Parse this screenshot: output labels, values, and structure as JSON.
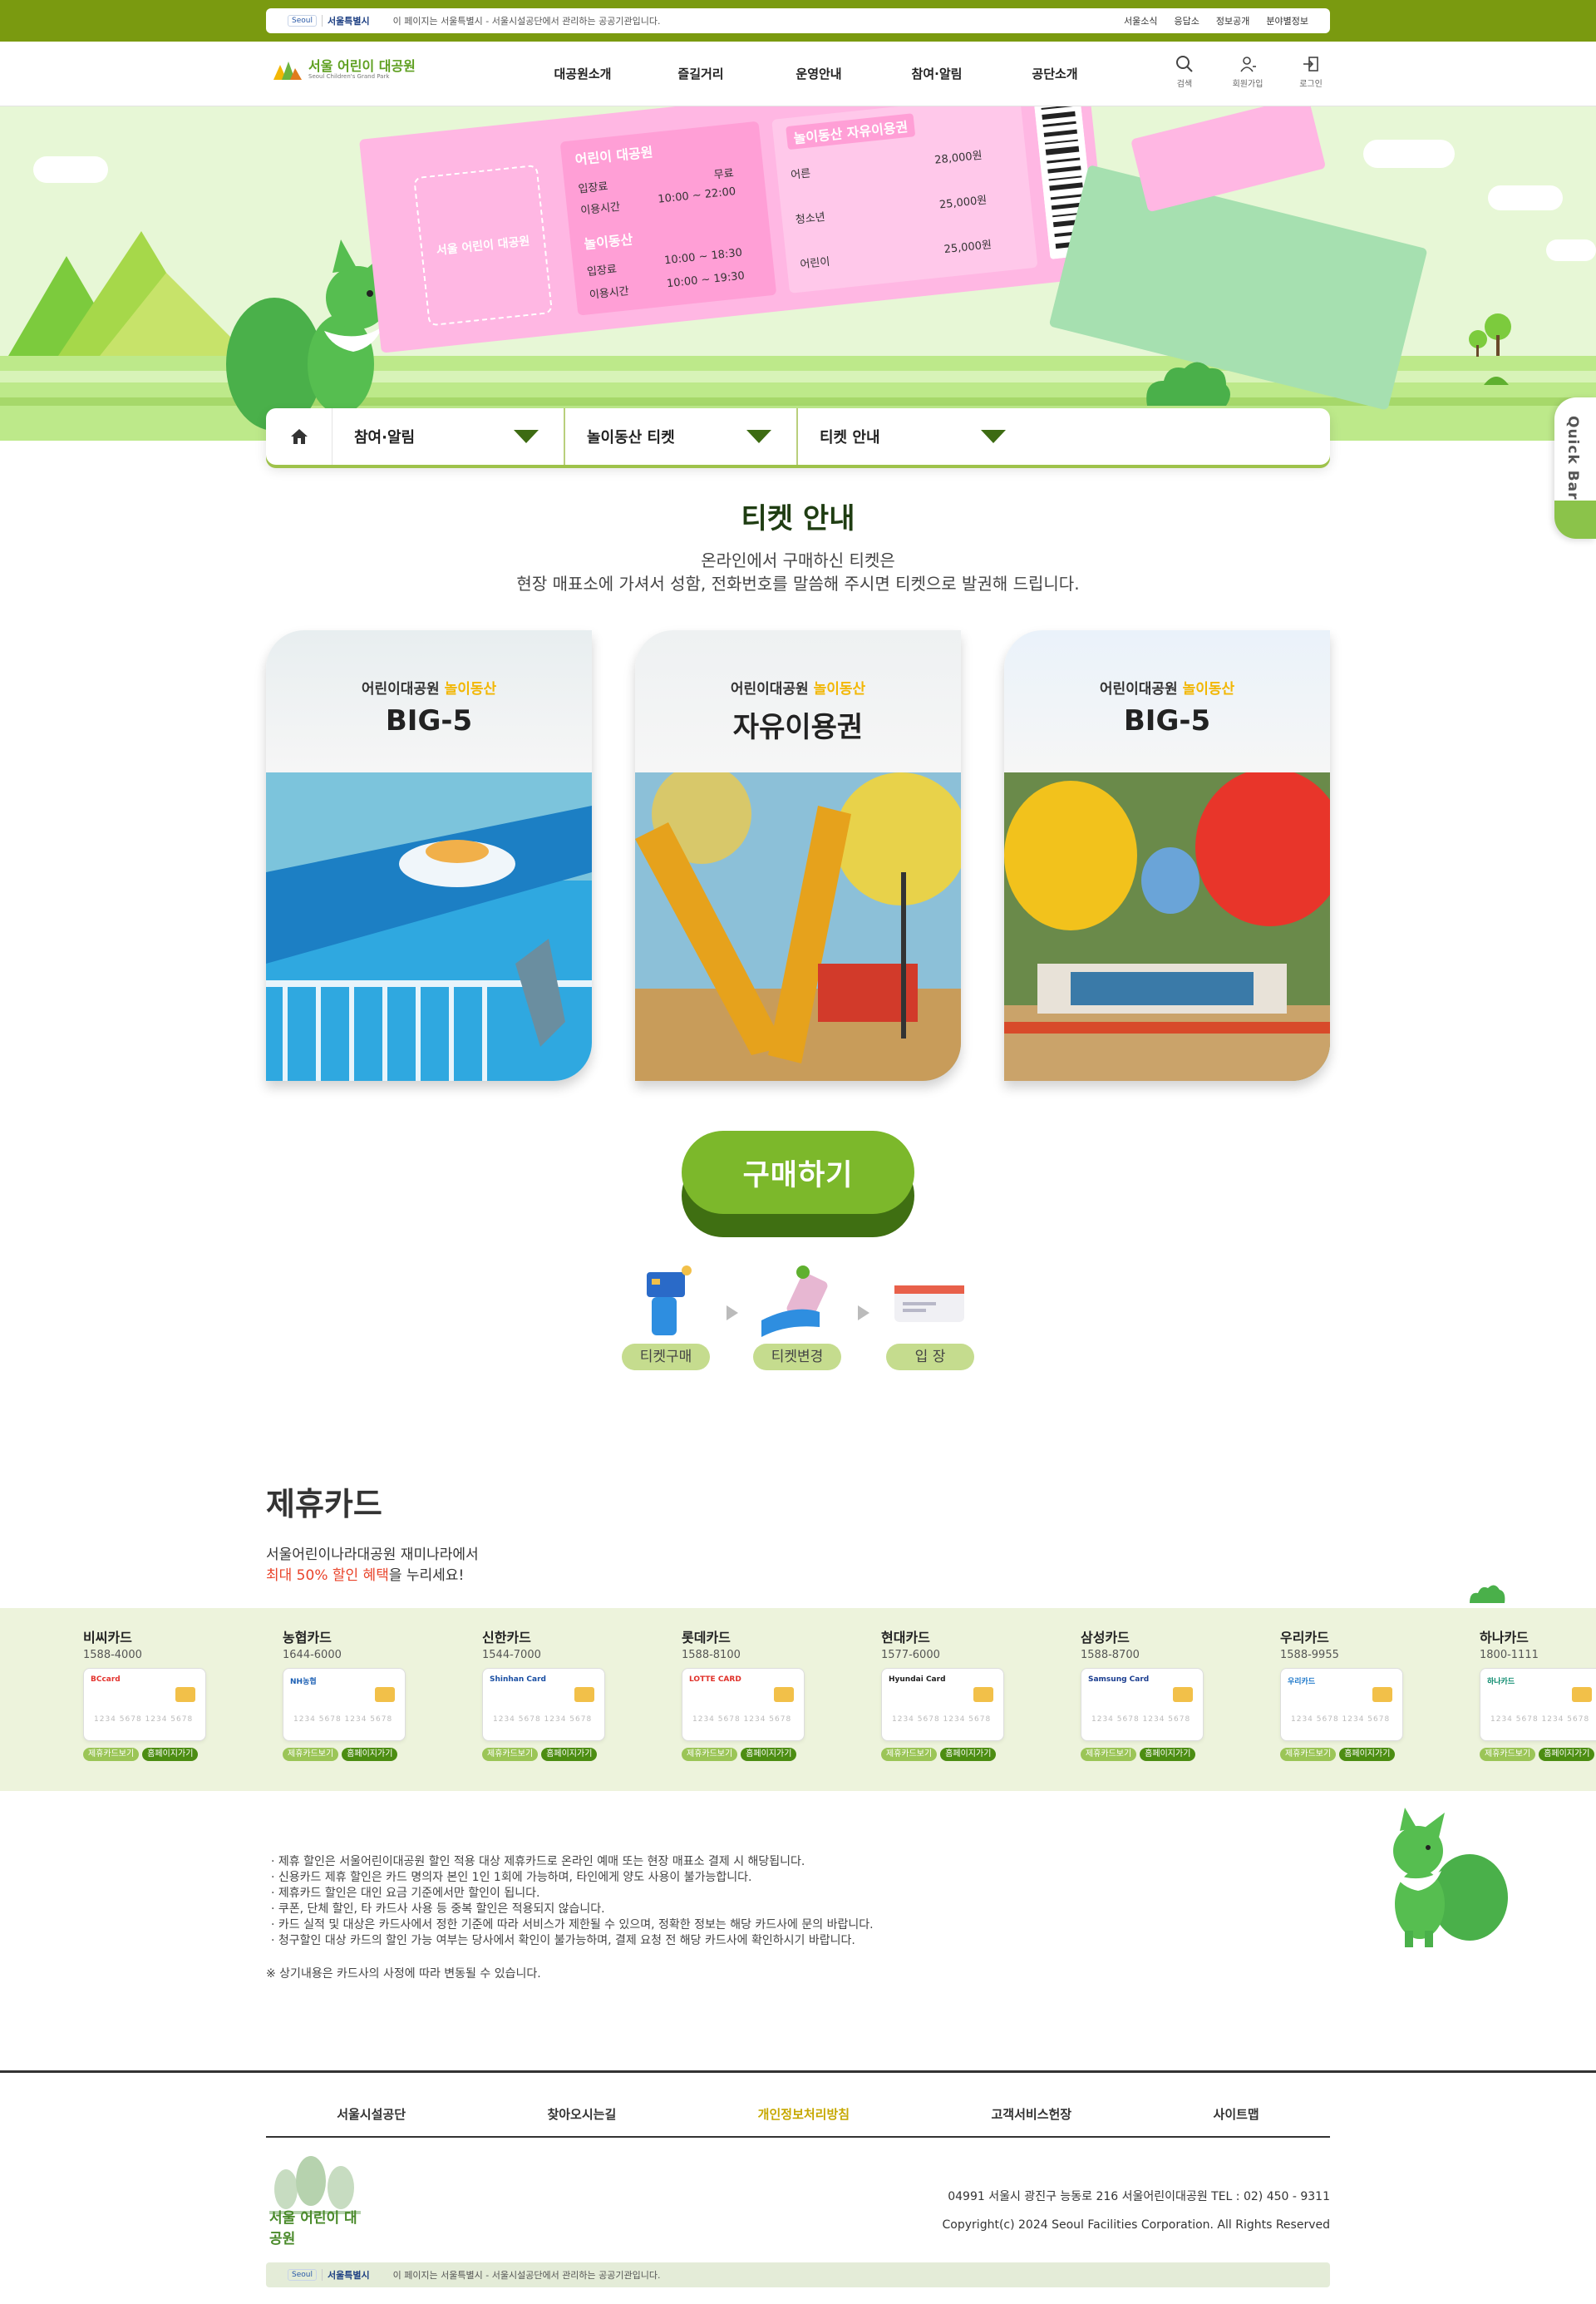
{
  "topbar": {
    "gov_logo_small": "Seoul",
    "gov_logo_main": "서울특별시",
    "notice": "이 페이지는 서울특별시 - 서울시설공단에서 관리하는 공공기관입니다.",
    "links": [
      "서울소식",
      "응답소",
      "정보공개",
      "분야별정보"
    ]
  },
  "header": {
    "logo_ko": "서울 어린이 대공원",
    "logo_en": "Seoul Children's Grand Park",
    "menu": [
      "대공원소개",
      "즐길거리",
      "운영안내",
      "참여·알림",
      "공단소개"
    ],
    "utils": {
      "search": "검색",
      "join": "회원가입",
      "login": "로그인"
    }
  },
  "hero": {
    "ticket_park_title": "어린이 대공원",
    "ticket_park_entry": "입장료",
    "ticket_park_entry_val": "무료",
    "ticket_park_hours": "이용시간",
    "ticket_park_hours_val": "10:00 ~ 22:00",
    "ticket_ride_title": "놀이동산",
    "ticket_ride_entry": "입장료",
    "ticket_ride_entry_val": "10:00 ~ 18:30",
    "ticket_ride_hours": "이용시간",
    "ticket_ride_hours_val": "10:00 ~ 19:30",
    "ticket_free_title": "놀이동산 자유이용권",
    "prices": [
      {
        "label": "어른",
        "value": "28,000원"
      },
      {
        "label": "청소년",
        "value": "25,000원"
      },
      {
        "label": "어린이",
        "value": "25,000원"
      }
    ],
    "stamp": "서울 어린이 대공원"
  },
  "subnav": {
    "items": [
      "참여·알림",
      "놀이동산 티켓",
      "티켓 안내"
    ]
  },
  "quickbar": {
    "label": "Quick Bar"
  },
  "main": {
    "title": "티켓 안내",
    "desc_line1": "온라인에서 구매하신 티켓은",
    "desc_line2": "현장 매표소에 가셔서 성함, 전화번호를 말씀해 주시면 티켓으로 발권해 드립니다.",
    "cards": [
      {
        "sub_a": "어린이대공원",
        "sub_b": "놀이동산",
        "big": "BIG-5"
      },
      {
        "sub_a": "어린이대공원",
        "sub_b": "놀이동산",
        "big": "자유이용권"
      },
      {
        "sub_a": "어린이대공원",
        "sub_b": "놀이동산",
        "big": "BIG-5"
      }
    ],
    "buy_button": "구매하기",
    "steps": [
      "티켓구매",
      "티켓변경",
      "입  장"
    ]
  },
  "partner": {
    "title": "제휴카드",
    "desc_line1": "서울어린이나라대공원 재미나라에서",
    "desc_highlight": "최대 50% 할인 혜택",
    "desc_tail": "을 누리세요!",
    "button_view": "제휴카드보기",
    "button_pay": "홈페이지가기",
    "card_number": "1234 5678 1234 5678",
    "cards": [
      {
        "name": "비씨카드",
        "tel": "1588-4000",
        "brand": "BCcard",
        "color": "#e3342f"
      },
      {
        "name": "농협카드",
        "tel": "1644-6000",
        "brand": "NH농협",
        "color": "#1b5fb4"
      },
      {
        "name": "신한카드",
        "tel": "1544-7000",
        "brand": "Shinhan Card",
        "color": "#1a4fa3"
      },
      {
        "name": "롯데카드",
        "tel": "1588-8100",
        "brand": "LOTTE CARD",
        "color": "#e0312a"
      },
      {
        "name": "현대카드",
        "tel": "1577-6000",
        "brand": "Hyundai Card",
        "color": "#222222"
      },
      {
        "name": "삼성카드",
        "tel": "1588-8700",
        "brand": "Samsung Card",
        "color": "#1a3d8f"
      },
      {
        "name": "우리카드",
        "tel": "1588-9955",
        "brand": "우리카드",
        "color": "#1a76c9"
      },
      {
        "name": "하나카드",
        "tel": "1800-1111",
        "brand": "하나카드",
        "color": "#0a8a6d"
      }
    ]
  },
  "notes": [
    "· 제휴 할인은 서울어린이대공원 할인 적용 대상 제휴카드로 온라인 예매 또는 현장 매표소 결제 시 해당됩니다.",
    "· 신용카드 제휴 할인은 카드 명의자 본인 1인 1회에 가능하며, 타인에게 양도 사용이 불가능합니다.",
    "· 제휴카드 할인은 대인 요금 기준에서만 할인이 됩니다.",
    "· 쿠폰, 단체 할인, 타 카드사 사용 등 중복 할인은 적용되지 않습니다.",
    "· 카드 실적 및 대상은 카드사에서 정한 기준에 따라 서비스가 제한될 수 있으며, 정확한 정보는 해당 카드사에 문의 바랍니다.",
    "· 청구할인 대상 카드의 할인 가능 여부는 당사에서 확인이 불가능하며, 결제 요청 전 해당 카드사에 확인하시기 바랍니다."
  ],
  "remark": "※ 상기내용은 카드사의 사정에 따라 변동될 수 있습니다.",
  "footer": {
    "nav": [
      "서울시설공단",
      "찾아오시는길",
      "개인정보처리방침",
      "고객서비스헌장",
      "사이트맵"
    ],
    "logo": "서울 어린이 대공원",
    "address": "04991 서울시 광진구 능동로 216 서울어린이대공원 TEL : 02) 450 - 9311",
    "copyright": "Copyright(c) 2024 Seoul Facilities Corporation. All Rights Reserved",
    "bar_notice": "이 페이지는 서울특별시 - 서울시설공단에서 관리하는 공공기관입니다."
  },
  "colors": {
    "brand_green": "#7cb82b",
    "topbar_olive": "#7a9a10",
    "ticket_pink": "#ffb7e3",
    "ticket_mint": "#a6e0b0",
    "highlight": "#e9442b"
  }
}
